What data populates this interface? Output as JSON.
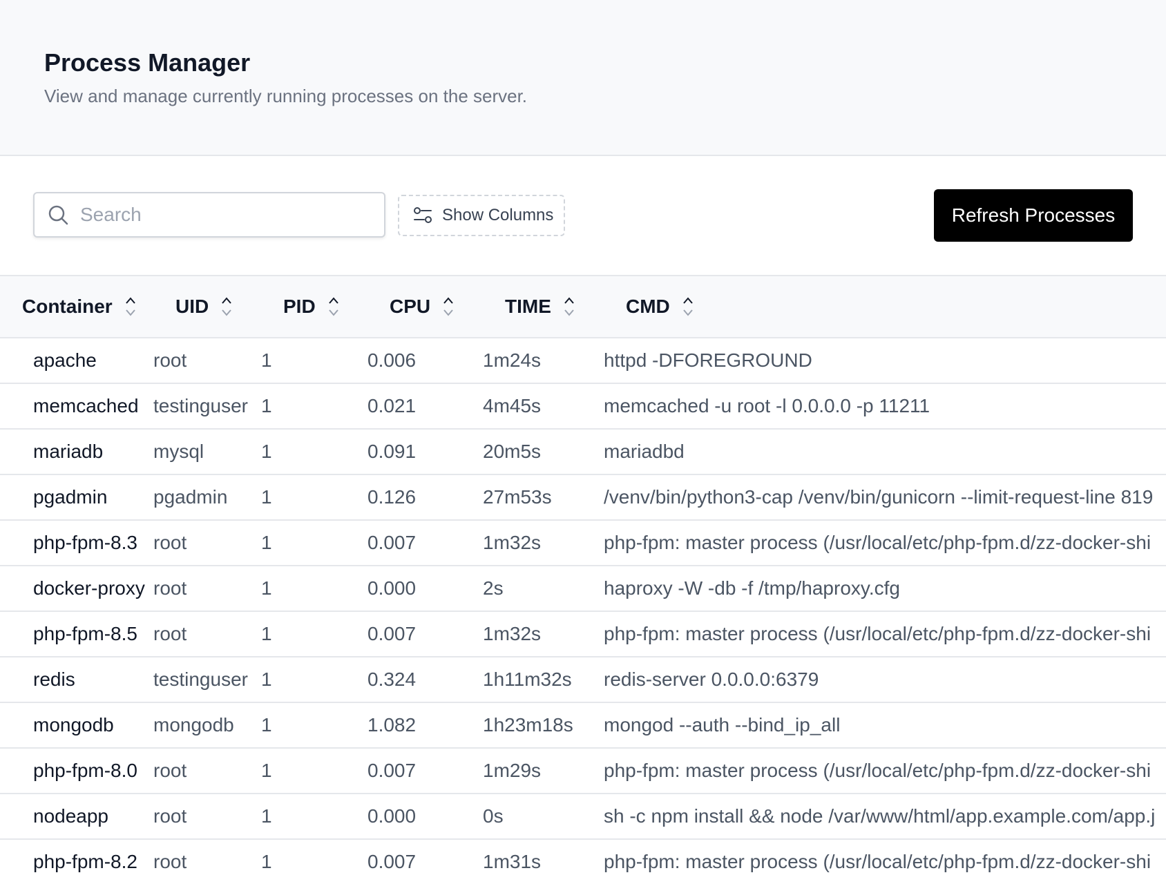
{
  "header": {
    "title": "Process Manager",
    "subtitle": "View and manage currently running processes on the server."
  },
  "toolbar": {
    "search_placeholder": "Search",
    "search_value": "",
    "search_icon": "search-icon",
    "columns_label": "Show Columns",
    "columns_icon": "sliders-icon",
    "refresh_label": "Refresh Processes"
  },
  "colors": {
    "header_bg": "#f8f9fb",
    "primary_button": "#000000",
    "border": "#e5e7eb",
    "muted_text": "#6b7280"
  },
  "table": {
    "columns": [
      "Container",
      "UID",
      "PID",
      "CPU",
      "TIME",
      "CMD"
    ],
    "rows": [
      [
        "apache",
        "root",
        "1",
        "0.006",
        "1m24s",
        "httpd -DFOREGROUND"
      ],
      [
        "memcached",
        "testinguser",
        "1",
        "0.021",
        "4m45s",
        "memcached -u root -l 0.0.0.0 -p 11211"
      ],
      [
        "mariadb",
        "mysql",
        "1",
        "0.091",
        "20m5s",
        "mariadbd"
      ],
      [
        "pgadmin",
        "pgadmin",
        "1",
        "0.126",
        "27m53s",
        "/venv/bin/python3-cap /venv/bin/gunicorn --limit-request-line 819"
      ],
      [
        "php-fpm-8.3",
        "root",
        "1",
        "0.007",
        "1m32s",
        "php-fpm: master process (/usr/local/etc/php-fpm.d/zz-docker-shi"
      ],
      [
        "docker-proxy",
        "root",
        "1",
        "0.000",
        "2s",
        "haproxy -W -db -f /tmp/haproxy.cfg"
      ],
      [
        "php-fpm-8.5",
        "root",
        "1",
        "0.007",
        "1m32s",
        "php-fpm: master process (/usr/local/etc/php-fpm.d/zz-docker-shi"
      ],
      [
        "redis",
        "testinguser",
        "1",
        "0.324",
        "1h11m32s",
        "redis-server 0.0.0.0:6379"
      ],
      [
        "mongodb",
        "mongodb",
        "1",
        "1.082",
        "1h23m18s",
        "mongod --auth --bind_ip_all"
      ],
      [
        "php-fpm-8.0",
        "root",
        "1",
        "0.007",
        "1m29s",
        "php-fpm: master process (/usr/local/etc/php-fpm.d/zz-docker-shi"
      ],
      [
        "nodeapp",
        "root",
        "1",
        "0.000",
        "0s",
        "sh -c npm install && node /var/www/html/app.example.com/app.j"
      ],
      [
        "php-fpm-8.2",
        "root",
        "1",
        "0.007",
        "1m31s",
        "php-fpm: master process (/usr/local/etc/php-fpm.d/zz-docker-shi"
      ]
    ]
  }
}
